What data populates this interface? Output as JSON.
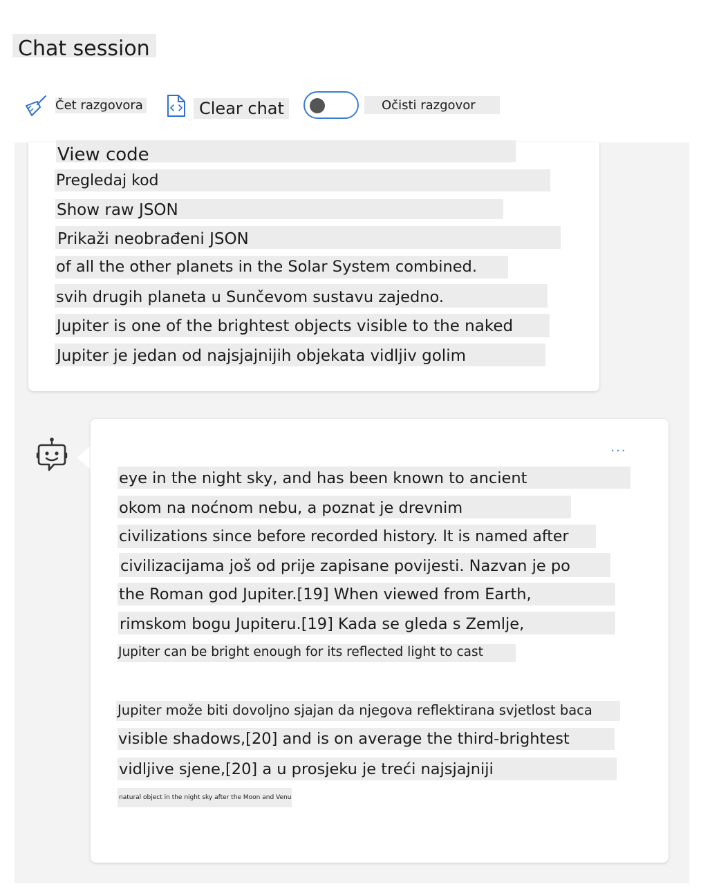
{
  "title": "Chat session",
  "toolbar": {
    "chat_label": "Čet razgovora",
    "clear_chat_label": "Clear chat",
    "clear_conversation_label": "Očisti razgovor"
  },
  "card1": {
    "view_code": "View code",
    "view_code_hr": "Pregledaj kod",
    "show_raw_json": "Show raw JSON",
    "show_raw_json_hr": "Prikaži neobrađeni JSON",
    "lines": [
      "of all the other planets in the Solar System combined.",
      "svih drugih planeta u Sunčevom sustavu zajedno.",
      "Jupiter is one of the brightest objects visible to the naked",
      "Jupiter je jedan od najsjajnijih objekata vidljiv golim"
    ]
  },
  "card2": {
    "more_label": "...",
    "lines": [
      "eye in the night sky, and has been known to ancient",
      "okom na noćnom nebu, a poznat je drevnim",
      "civilizations since before recorded history. It is named after",
      "civilizacijama još od prije zapisane povijesti. Nazvan je po",
      "the Roman god Jupiter.[19] When viewed from Earth,",
      "rimskom bogu Jupiteru.[19] Kada se gleda s Zemlje,",
      "Jupiter can be bright enough for its reflected light to cast",
      "Jupiter može biti dovoljno sjajan da njegova reflektirana svjetlost baca",
      "visible shadows,[20] and is on average the third-brightest",
      "vidljive sjene,[20] a u prosjeku je treći najsjajniji",
      "natural object in the night sky after the Moon and Venus."
    ]
  }
}
